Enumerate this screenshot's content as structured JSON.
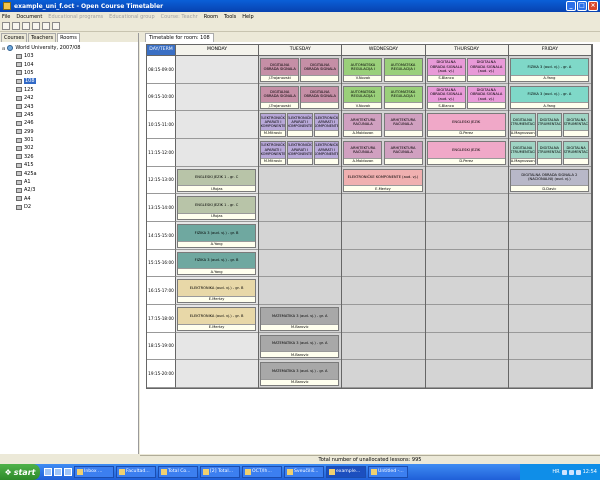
{
  "window": {
    "title": "example_uni_f.oct - Open Course Timetabler"
  },
  "menu": [
    {
      "label": "File",
      "disabled": false
    },
    {
      "label": "Document",
      "disabled": false
    },
    {
      "label": "Educational programs",
      "disabled": true
    },
    {
      "label": "Educational group",
      "disabled": true
    },
    {
      "label": "Course: Teachr",
      "disabled": true
    },
    {
      "label": "Room",
      "disabled": false
    },
    {
      "label": "Tools",
      "disabled": false
    },
    {
      "label": "Help",
      "disabled": false
    }
  ],
  "left": {
    "tabs": [
      {
        "label": "Courses",
        "active": false
      },
      {
        "label": "Teachers",
        "active": false
      },
      {
        "label": "Rooms",
        "active": true
      }
    ],
    "root": "World University, 2007/08",
    "rooms": [
      "103",
      "104",
      "105",
      "108",
      "125",
      "242",
      "243",
      "245",
      "246",
      "299",
      "301",
      "302",
      "326",
      "415",
      "425a",
      "A1",
      "A2/3",
      "A4",
      "D2"
    ],
    "selected": "108"
  },
  "timetable": {
    "tab": "Timetable for room: 108",
    "corner": "DAY/TERM",
    "days": [
      "MONDAY",
      "TUESDAY",
      "WEDNESDAY",
      "THURSDAY",
      "FRIDAY"
    ],
    "times": [
      "08:15-09:00",
      "09:15-10:00",
      "10:15-11:00",
      "11:15-12:00",
      "12:15-13:00",
      "13:15-14:00",
      "14:15-15:00",
      "15:15-16:00",
      "16:15-17:00",
      "17:15-18:00",
      "18:15-19:00",
      "19:15-20:00"
    ],
    "lessons": [
      {
        "day": 1,
        "row": 0,
        "sub": 0,
        "of": 2,
        "text": "DIGITALNA OBRADA SIGNALA",
        "teacher": "J.Trajanovski",
        "color": "#c58fa6"
      },
      {
        "day": 1,
        "row": 0,
        "sub": 1,
        "of": 2,
        "text": "DIGITALNA OBRADA SIGNALA",
        "teacher": "",
        "color": "#c58fa6"
      },
      {
        "day": 2,
        "row": 0,
        "sub": 0,
        "of": 2,
        "text": "AUTOMATSKA REGULACIJA I",
        "teacher": "V.Novak",
        "color": "#9ad07a"
      },
      {
        "day": 2,
        "row": 0,
        "sub": 1,
        "of": 2,
        "text": "AUTOMATSKA REGULACIJA I",
        "teacher": "",
        "color": "#9ad07a"
      },
      {
        "day": 3,
        "row": 0,
        "sub": 0,
        "of": 2,
        "text": "DIGITALNA OBRADA SIGNALA (aud. vj.)",
        "teacher": "S.Blanco",
        "color": "#e89ad8"
      },
      {
        "day": 3,
        "row": 0,
        "sub": 1,
        "of": 2,
        "text": "DIGITALNA OBRADA SIGNALA (aud. vj.)",
        "teacher": "",
        "color": "#e89ad8"
      },
      {
        "day": 4,
        "row": 0,
        "sub": 0,
        "of": 1,
        "text": "FIZIKA 3 (aud. vj.) - gr. A",
        "teacher": "A.Yang",
        "color": "#7fd8c8"
      },
      {
        "day": 1,
        "row": 1,
        "sub": 0,
        "of": 2,
        "text": "DIGITALNA OBRADA SIGNALA",
        "teacher": "J.Trajanovski",
        "color": "#c58fa6"
      },
      {
        "day": 1,
        "row": 1,
        "sub": 1,
        "of": 2,
        "text": "DIGITALNA OBRADA SIGNALA",
        "teacher": "",
        "color": "#c58fa6"
      },
      {
        "day": 2,
        "row": 1,
        "sub": 0,
        "of": 2,
        "text": "AUTOMATSKA REGULACIJA I",
        "teacher": "V.Novak",
        "color": "#9ad07a"
      },
      {
        "day": 2,
        "row": 1,
        "sub": 1,
        "of": 2,
        "text": "AUTOMATSKA REGULACIJA I",
        "teacher": "",
        "color": "#9ad07a"
      },
      {
        "day": 3,
        "row": 1,
        "sub": 0,
        "of": 2,
        "text": "DIGITALNA OBRADA SIGNALA (aud. vj.)",
        "teacher": "S.Blanco",
        "color": "#e89ad8"
      },
      {
        "day": 3,
        "row": 1,
        "sub": 1,
        "of": 2,
        "text": "DIGITALNA OBRADA SIGNALA (aud. vj.)",
        "teacher": "",
        "color": "#e89ad8"
      },
      {
        "day": 4,
        "row": 1,
        "sub": 0,
        "of": 1,
        "text": "FIZIKA 3 (aud. vj.) - gr. A",
        "teacher": "A.Yang",
        "color": "#7fd8c8"
      },
      {
        "day": 1,
        "row": 2,
        "sub": 0,
        "of": 3,
        "text": "ELEKTRONIČKI APARATI I KOMPONENTE",
        "teacher": "M.Mitrovic",
        "color": "#b8a8d8"
      },
      {
        "day": 1,
        "row": 2,
        "sub": 1,
        "of": 3,
        "text": "ELEKTRONIČKI APARATI I KOMPONENTE",
        "teacher": "",
        "color": "#b8a8d8"
      },
      {
        "day": 1,
        "row": 2,
        "sub": 2,
        "of": 3,
        "text": "ELEKTRONIČKI APARATI I KOMPONENTE",
        "teacher": "",
        "color": "#b8a8d8"
      },
      {
        "day": 2,
        "row": 2,
        "sub": 0,
        "of": 2,
        "text": "ARHITEKTURA RAČUNALA",
        "teacher": "A.Moldovan",
        "color": "#d0a0c0"
      },
      {
        "day": 2,
        "row": 2,
        "sub": 1,
        "of": 2,
        "text": "ARHITEKTURA RAČUNALA",
        "teacher": "",
        "color": "#d0a0c0"
      },
      {
        "day": 3,
        "row": 2,
        "sub": 0,
        "of": 1,
        "text": "ENGLESKI JEZIK",
        "teacher": "D.Perez",
        "color": "#f0a8c8"
      },
      {
        "day": 4,
        "row": 2,
        "sub": 0,
        "of": 3,
        "text": "DIGITALNA INSTRUMENTACIJA",
        "teacher": "A.Magnusson",
        "color": "#9fd4c4"
      },
      {
        "day": 4,
        "row": 2,
        "sub": 1,
        "of": 3,
        "text": "DIGITALNA INSTRUMENTACIJA",
        "teacher": "",
        "color": "#9fd4c4"
      },
      {
        "day": 4,
        "row": 2,
        "sub": 2,
        "of": 3,
        "text": "DIGITALNA INSTRUMENTACIJA",
        "teacher": "",
        "color": "#9fd4c4"
      },
      {
        "day": 1,
        "row": 3,
        "sub": 0,
        "of": 3,
        "text": "ELEKTRONIČKI APARATI I KOMPONENTE",
        "teacher": "M.Mitrovic",
        "color": "#b8a8d8"
      },
      {
        "day": 1,
        "row": 3,
        "sub": 1,
        "of": 3,
        "text": "ELEKTRONIČKI APARATI I KOMPONENTE",
        "teacher": "",
        "color": "#b8a8d8"
      },
      {
        "day": 1,
        "row": 3,
        "sub": 2,
        "of": 3,
        "text": "ELEKTRONIČKI APARATI I KOMPONENTE",
        "teacher": "",
        "color": "#b8a8d8"
      },
      {
        "day": 2,
        "row": 3,
        "sub": 0,
        "of": 2,
        "text": "ARHITEKTURA RAČUNALA",
        "teacher": "A.Moldovan",
        "color": "#d0a0c0"
      },
      {
        "day": 2,
        "row": 3,
        "sub": 1,
        "of": 2,
        "text": "ARHITEKTURA RAČUNALA",
        "teacher": "",
        "color": "#d0a0c0"
      },
      {
        "day": 3,
        "row": 3,
        "sub": 0,
        "of": 1,
        "text": "ENGLESKI JEZIK",
        "teacher": "D.Perez",
        "color": "#f0a8c8"
      },
      {
        "day": 4,
        "row": 3,
        "sub": 0,
        "of": 3,
        "text": "DIGITALNA INSTRUMENTACIJA",
        "teacher": "A.Magnusson",
        "color": "#9fd4c4"
      },
      {
        "day": 4,
        "row": 3,
        "sub": 1,
        "of": 3,
        "text": "DIGITALNA INSTRUMENTACIJA",
        "teacher": "",
        "color": "#9fd4c4"
      },
      {
        "day": 4,
        "row": 3,
        "sub": 2,
        "of": 3,
        "text": "DIGITALNA INSTRUMENTACIJA",
        "teacher": "",
        "color": "#9fd4c4"
      },
      {
        "day": 0,
        "row": 4,
        "sub": 0,
        "of": 1,
        "text": "ENGLESKI JEZIK 1 - gr. C",
        "teacher": "I.Rojas",
        "color": "#b8c4a8"
      },
      {
        "day": 2,
        "row": 4,
        "sub": 0,
        "of": 1,
        "text": "ELEKTRONIČKE KOMPONENTE (aud. vj.)",
        "teacher": "E.Mertzy",
        "color": "#f0b0b0"
      },
      {
        "day": 4,
        "row": 4,
        "sub": 0,
        "of": 1,
        "text": "DIGITALNA OBRADA SIGNALA 2 (NACIONALNI) (aud. vj.)",
        "teacher": "D.Davic",
        "color": "#b8b8c8"
      },
      {
        "day": 0,
        "row": 5,
        "sub": 0,
        "of": 1,
        "text": "ENGLESKI JEZIK 1 - gr. C",
        "teacher": "I.Rojas",
        "color": "#b8c4a8"
      },
      {
        "day": 0,
        "row": 6,
        "sub": 0,
        "of": 1,
        "text": "FIZIKA 3 (aud. vj.) - gr. B",
        "teacher": "A.Yang",
        "color": "#6fa8a0"
      },
      {
        "day": 0,
        "row": 7,
        "sub": 0,
        "of": 1,
        "text": "FIZIKA 3 (aud. vj.) - gr. B",
        "teacher": "A.Yang",
        "color": "#6fa8a0"
      },
      {
        "day": 0,
        "row": 8,
        "sub": 0,
        "of": 1,
        "text": "ELEKTRONIKA (aud. vj.) - gr. B",
        "teacher": "E.Mertzy",
        "color": "#e8d8a8"
      },
      {
        "day": 0,
        "row": 9,
        "sub": 0,
        "of": 1,
        "text": "ELEKTRONIKA (aud. vj.) - gr. B",
        "teacher": "E.Mertzy",
        "color": "#e8d8a8"
      },
      {
        "day": 1,
        "row": 9,
        "sub": 0,
        "of": 1,
        "text": "MATEMATIKA 3 (aud. vj.) - gr. A",
        "teacher": "M.Barovic",
        "color": "#a8a8a8"
      },
      {
        "day": 1,
        "row": 10,
        "sub": 0,
        "of": 1,
        "text": "MATEMATIKA 3 (aud. vj.) - gr. A",
        "teacher": "M.Barovic",
        "color": "#a8a8a8"
      },
      {
        "day": 1,
        "row": 11,
        "sub": 0,
        "of": 1,
        "text": "MATEMATIKA 3 (aud. vj.) - gr. A",
        "teacher": "M.Barovic",
        "color": "#a8a8a8"
      }
    ]
  },
  "status": "Total number of unallocated lessons: 995",
  "taskbar": {
    "start": "start",
    "tasks": [
      "Inbox ...",
      "Facultad...",
      "Total Co...",
      "[2] Total...",
      "OCT/Ih...",
      "Sveučiliš...",
      "example...",
      "Untitled -..."
    ],
    "active_task": 6,
    "lang": "HR",
    "clock": "12:54"
  }
}
